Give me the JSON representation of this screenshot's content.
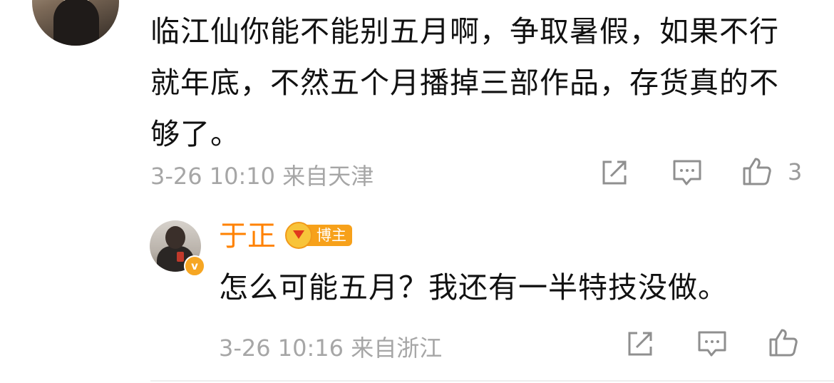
{
  "comment": {
    "text": "临江仙你能不能别五月啊，争取暑假，如果不行就年底，不然五个月播掉三部作品，存货真的不够了。",
    "meta": "3-26 10:10 来自天津",
    "like_count": "3",
    "icons": [
      "share-icon",
      "comment-icon",
      "thumbs-up-icon"
    ]
  },
  "reply": {
    "author": "于正",
    "badge": "博主",
    "text": "怎么可能五月？我还有一半特技没做。",
    "meta": "3-26 10:16 来自浙江",
    "icons": [
      "share-icon",
      "comment-icon",
      "thumbs-up-icon"
    ]
  },
  "colors": {
    "author_name": "#ff8200",
    "meta_text": "#a6a6a6",
    "body_text": "#111111",
    "badge_bg": "#f7a11a",
    "verified_badge": "#f6a623"
  }
}
